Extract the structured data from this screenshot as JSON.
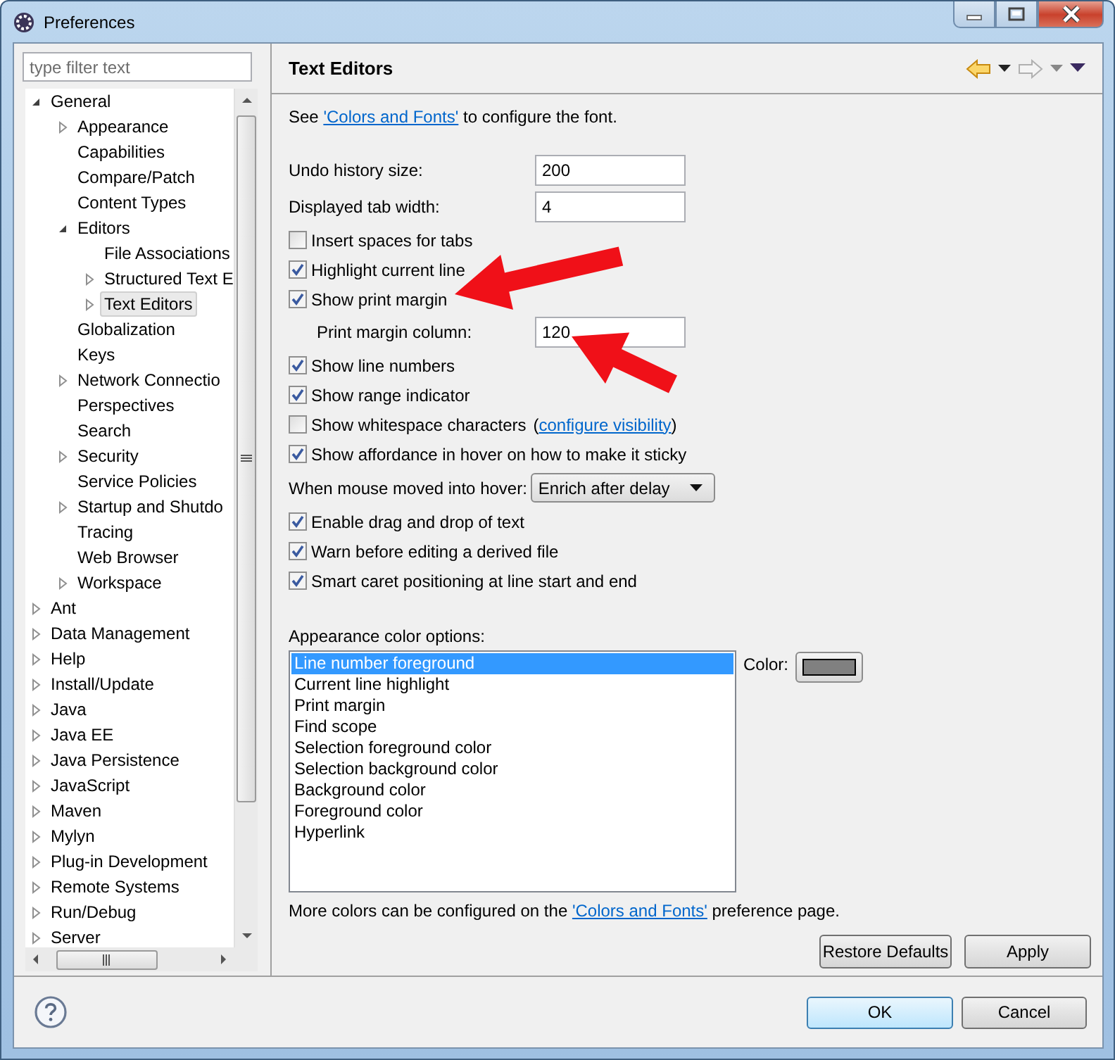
{
  "window": {
    "title": "Preferences"
  },
  "filter": {
    "placeholder": "type filter text"
  },
  "tree": [
    {
      "label": "General",
      "expanded": true,
      "selected": false,
      "children": [
        {
          "label": "Appearance",
          "expanded": false,
          "selected": false
        },
        {
          "label": "Capabilities",
          "selected": false
        },
        {
          "label": "Compare/Patch",
          "selected": false
        },
        {
          "label": "Content Types",
          "selected": false
        },
        {
          "label": "Editors",
          "expanded": true,
          "selected": false,
          "children": [
            {
              "label": "File Associations",
              "selected": false
            },
            {
              "label": "Structured Text E",
              "expanded": false,
              "selected": false
            },
            {
              "label": "Text Editors",
              "expanded": false,
              "selected": true
            }
          ]
        },
        {
          "label": "Globalization",
          "selected": false
        },
        {
          "label": "Keys",
          "selected": false
        },
        {
          "label": "Network Connectio",
          "expanded": false,
          "selected": false
        },
        {
          "label": "Perspectives",
          "selected": false
        },
        {
          "label": "Search",
          "selected": false
        },
        {
          "label": "Security",
          "expanded": false,
          "selected": false
        },
        {
          "label": "Service Policies",
          "selected": false
        },
        {
          "label": "Startup and Shutdo",
          "expanded": false,
          "selected": false
        },
        {
          "label": "Tracing",
          "selected": false
        },
        {
          "label": "Web Browser",
          "selected": false
        },
        {
          "label": "Workspace",
          "expanded": false,
          "selected": false
        }
      ]
    },
    {
      "label": "Ant",
      "expanded": false,
      "selected": false
    },
    {
      "label": "Data Management",
      "expanded": false,
      "selected": false
    },
    {
      "label": "Help",
      "expanded": false,
      "selected": false
    },
    {
      "label": "Install/Update",
      "expanded": false,
      "selected": false
    },
    {
      "label": "Java",
      "expanded": false,
      "selected": false
    },
    {
      "label": "Java EE",
      "expanded": false,
      "selected": false
    },
    {
      "label": "Java Persistence",
      "expanded": false,
      "selected": false
    },
    {
      "label": "JavaScript",
      "expanded": false,
      "selected": false
    },
    {
      "label": "Maven",
      "expanded": false,
      "selected": false
    },
    {
      "label": "Mylyn",
      "expanded": false,
      "selected": false
    },
    {
      "label": "Plug-in Development",
      "expanded": false,
      "selected": false
    },
    {
      "label": "Remote Systems",
      "expanded": false,
      "selected": false
    },
    {
      "label": "Run/Debug",
      "expanded": false,
      "selected": false
    },
    {
      "label": "Server",
      "expanded": false,
      "selected": false
    }
  ],
  "page": {
    "title": "Text Editors"
  },
  "settings": [
    {
      "kind": "note",
      "before": "See ",
      "link": "'Colors and Fonts'",
      "after": " to configure the font."
    },
    {
      "kind": "number",
      "label": "Undo history size:",
      "value": "200",
      "indented": false
    },
    {
      "kind": "number",
      "label": "Displayed tab width:",
      "value": "4",
      "indented": false
    },
    {
      "kind": "checkbox",
      "label": "Insert spaces for tabs",
      "checked": false
    },
    {
      "kind": "checkbox",
      "label": "Highlight current line",
      "checked": true
    },
    {
      "kind": "checkbox",
      "label": "Show print margin",
      "checked": true
    },
    {
      "kind": "number",
      "label": "Print margin column:",
      "value": "120",
      "indented": true
    },
    {
      "kind": "checkbox",
      "label": "Show line numbers",
      "checked": true
    },
    {
      "kind": "checkbox",
      "label": "Show range indicator",
      "checked": true
    },
    {
      "kind": "checkbox",
      "label": "Show whitespace characters",
      "checked": false,
      "note": {
        "before": "(",
        "link": "configure visibility",
        "after": ")"
      }
    },
    {
      "kind": "checkbox",
      "label": "Show affordance in hover on how to make it sticky",
      "checked": true
    },
    {
      "kind": "select",
      "label": "When mouse moved into hover:",
      "value": "Enrich after delay"
    },
    {
      "kind": "checkbox",
      "label": "Enable drag and drop of text",
      "checked": true
    },
    {
      "kind": "checkbox",
      "label": "Warn before editing a derived file",
      "checked": true
    },
    {
      "kind": "checkbox",
      "label": "Smart caret positioning at line start and end",
      "checked": true
    }
  ],
  "appearance": {
    "label": "Appearance color options:",
    "items": [
      {
        "label": "Line number foreground",
        "selected": true
      },
      {
        "label": "Current line highlight",
        "selected": false
      },
      {
        "label": "Print margin",
        "selected": false
      },
      {
        "label": "Find scope",
        "selected": false
      },
      {
        "label": "Selection foreground color",
        "selected": false
      },
      {
        "label": "Selection background color",
        "selected": false
      },
      {
        "label": "Background color",
        "selected": false
      },
      {
        "label": "Foreground color",
        "selected": false
      },
      {
        "label": "Hyperlink",
        "selected": false
      }
    ],
    "color_label": "Color:",
    "color": "#808080"
  },
  "more": {
    "before": "More colors can be configured on the ",
    "link": "'Colors and Fonts'",
    "after": " preference page."
  },
  "page_buttons": [
    "Restore Defaults",
    "Apply"
  ],
  "dialog_buttons": [
    {
      "label": "OK",
      "default": true
    },
    {
      "label": "Cancel",
      "default": false
    }
  ]
}
